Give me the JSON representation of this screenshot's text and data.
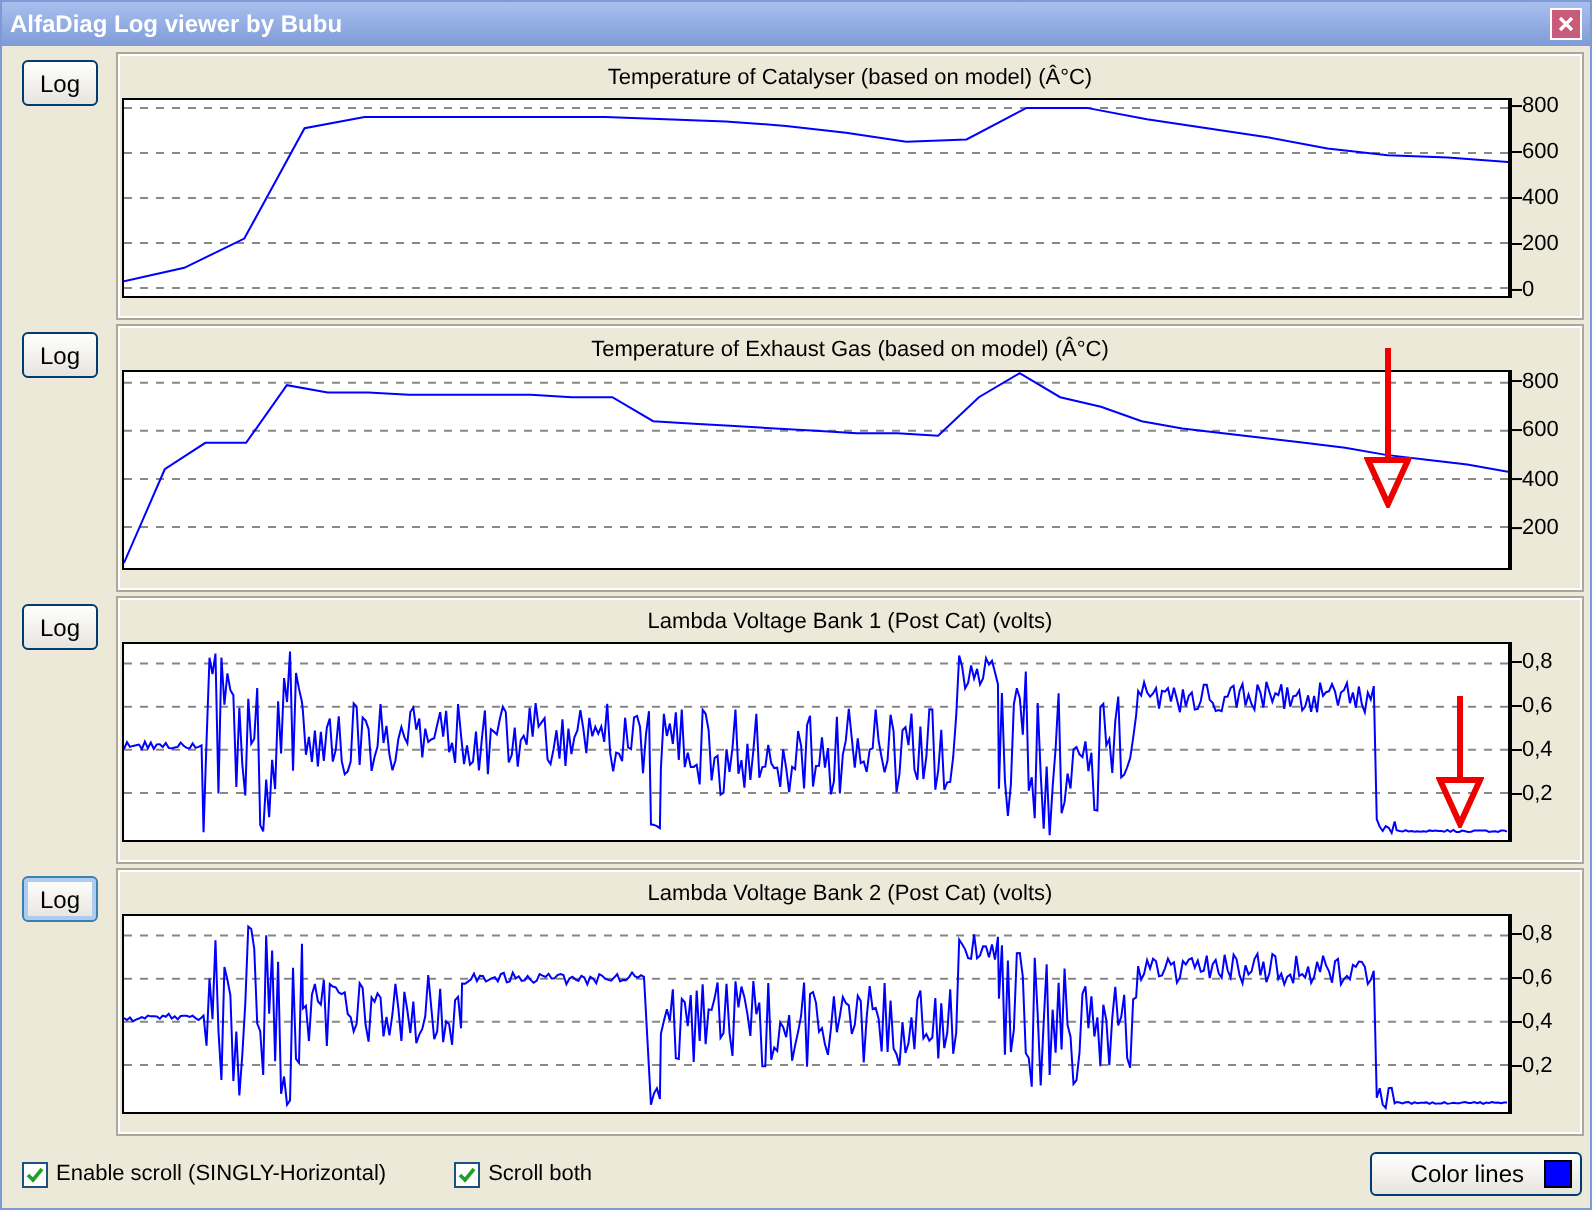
{
  "window": {
    "title": "AlfaDiag Log viewer by Bubu"
  },
  "charts": [
    {
      "log_button": "Log",
      "focused": false,
      "kind": "temperature",
      "arrow": false,
      "chart_data": {
        "type": "line",
        "title": "Temperature of Catalyser (based on model) (Â°C)",
        "ylim": [
          -35,
          835
        ],
        "yticks": [
          800,
          600,
          400,
          200,
          0
        ],
        "grid": true,
        "series": [
          {
            "color": "#0000ff",
            "values": [
              30,
              90,
              220,
              710,
              760,
              760,
              760,
              760,
              760,
              750,
              740,
              720,
              690,
              650,
              660,
              800,
              800,
              750,
              710,
              670,
              620,
              590,
              580,
              560
            ]
          }
        ]
      }
    },
    {
      "log_button": "Log",
      "focused": false,
      "kind": "temperature",
      "arrow": true,
      "chart_data": {
        "type": "line",
        "title": "Temperature of Exhaust Gas (based on model) (Â°C)",
        "ylim": [
          29,
          845
        ],
        "yticks": [
          800,
          600,
          400,
          200
        ],
        "grid": true,
        "series": [
          {
            "color": "#0000ff",
            "values": [
              50,
              440,
              550,
              550,
              790,
              760,
              760,
              750,
              750,
              750,
              750,
              740,
              740,
              640,
              630,
              620,
              610,
              600,
              590,
              590,
              580,
              740,
              840,
              740,
              700,
              640,
              610,
              590,
              570,
              550,
              530,
              500,
              480,
              460,
              430
            ]
          }
        ]
      }
    },
    {
      "log_button": "Log",
      "focused": false,
      "title": "Lambda Voltage Bank 1 (Post Cat) (volts)",
      "kind": "lambda",
      "yticks": [
        "0,8",
        "0,6",
        "0,4",
        "0,2"
      ],
      "arrow": true
    },
    {
      "log_button": "Log",
      "focused": true,
      "title": "Lambda Voltage Bank 2 (Post Cat) (volts)",
      "kind": "lambda",
      "yticks": [
        "0,8",
        "0,6",
        "0,4",
        "0,2"
      ],
      "arrow": false
    }
  ],
  "options": [
    {
      "label": "Enable scroll (SINGLY-Horizontal)",
      "checked": true
    },
    {
      "label": "Scroll both",
      "checked": true
    }
  ],
  "color_button": {
    "label": "Color lines"
  }
}
